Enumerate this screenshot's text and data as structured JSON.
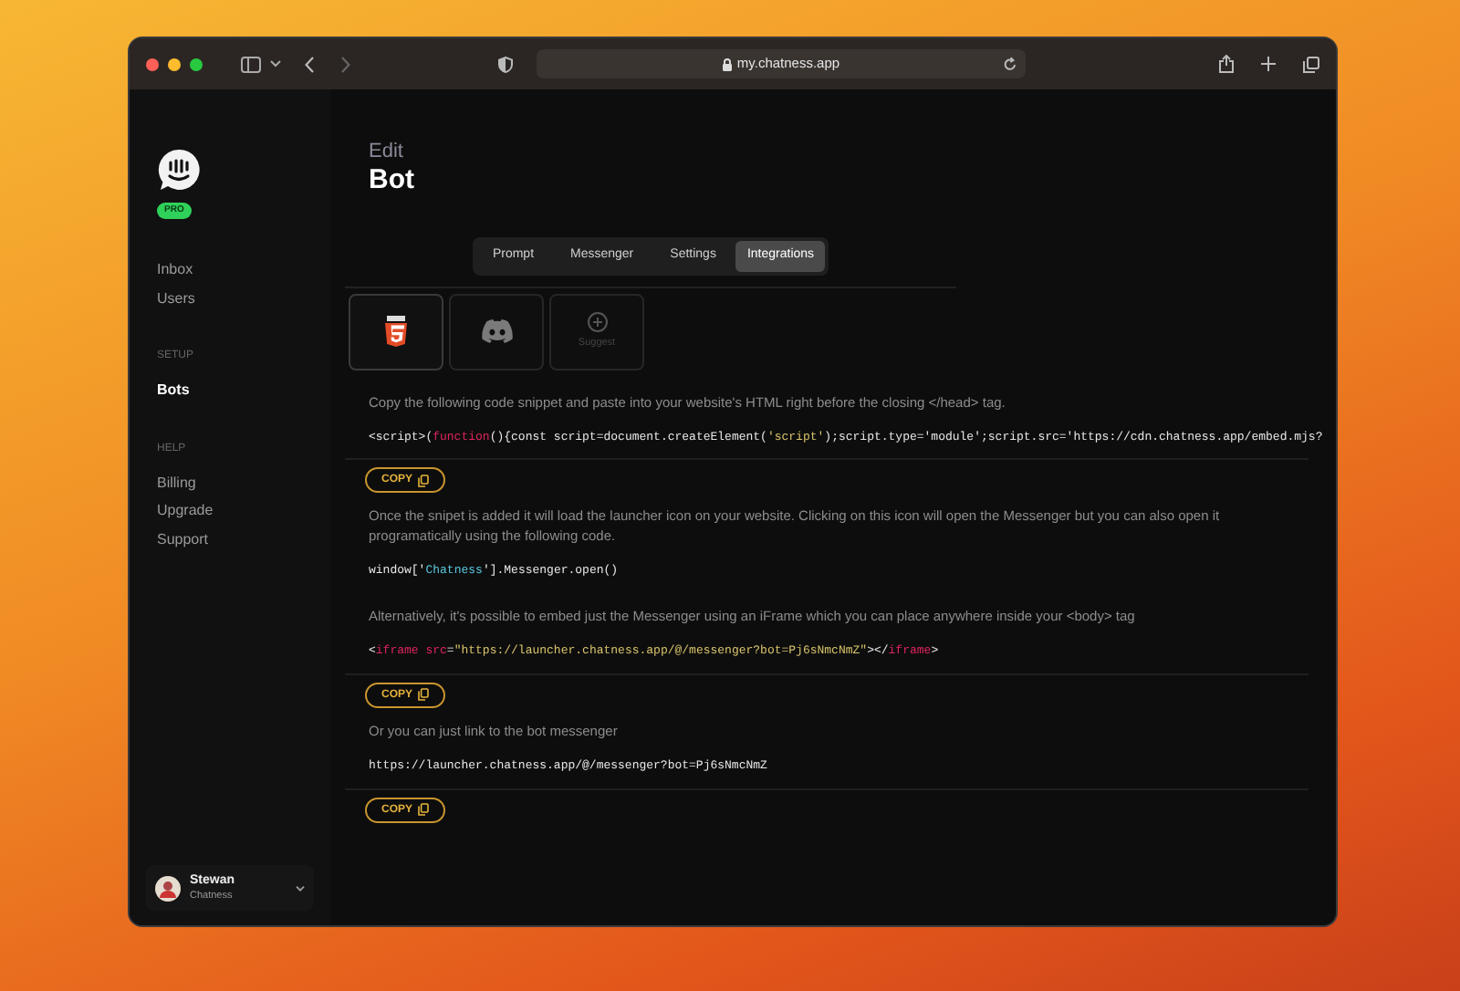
{
  "browser": {
    "url": "my.chatness.app"
  },
  "sidebar": {
    "badge": "PRO",
    "groups": [
      {
        "items": [
          {
            "label": "Inbox",
            "selected": false
          },
          {
            "label": "Users",
            "selected": false
          }
        ]
      },
      {
        "heading": "SETUP",
        "items": [
          {
            "label": "Bots",
            "selected": true
          }
        ]
      },
      {
        "heading": "HELP",
        "items": [
          {
            "label": "Billing",
            "selected": false
          },
          {
            "label": "Upgrade",
            "selected": false
          },
          {
            "label": "Support",
            "selected": false
          }
        ]
      }
    ],
    "user": {
      "name": "Stewan",
      "org": "Chatness"
    }
  },
  "header": {
    "overline": "Edit",
    "title": "Bot"
  },
  "tabs": [
    {
      "label": "Prompt",
      "selected": false
    },
    {
      "label": "Messenger",
      "selected": false
    },
    {
      "label": "Settings",
      "selected": false
    },
    {
      "label": "Integrations",
      "selected": true
    }
  ],
  "integrations": [
    {
      "kind": "html5",
      "selected": true
    },
    {
      "kind": "discord",
      "selected": false
    },
    {
      "kind": "suggest",
      "label": "Suggest",
      "selected": false
    }
  ],
  "blocks": [
    {
      "kind": "text",
      "text": "Copy the following code snippet and paste into your website's HTML right before the closing </head> tag."
    },
    {
      "kind": "code",
      "tokens": [
        {
          "kind": "plain",
          "text": "<script>("
        },
        {
          "kind": "keyword",
          "text": "function"
        },
        {
          "kind": "plain",
          "text": "(){const script=document.createElement("
        },
        {
          "kind": "string",
          "text": "'script'"
        },
        {
          "kind": "plain",
          "text": ");script.type='module';script.src='https://cdn.chatness.app/embed.mjs?"
        }
      ]
    },
    {
      "kind": "copy",
      "label": "COPY"
    },
    {
      "kind": "text",
      "text": "Once the snipet is added it will load the launcher icon on your website. Clicking on this icon will open the Messenger but you can also open it programatically using the following code."
    },
    {
      "kind": "code",
      "tokens": [
        {
          "kind": "plain",
          "text": "window['"
        },
        {
          "kind": "name",
          "text": "Chatness"
        },
        {
          "kind": "plain",
          "text": "'].Messenger.open()"
        }
      ]
    },
    {
      "kind": "text",
      "text": "Alternatively, it's possible to embed just the Messenger using an iFrame which you can place anywhere inside your <body> tag"
    },
    {
      "kind": "code",
      "tokens": [
        {
          "kind": "plain",
          "text": "<"
        },
        {
          "kind": "keyword",
          "text": "iframe src"
        },
        {
          "kind": "plain",
          "text": "="
        },
        {
          "kind": "string",
          "text": "\"https://launcher.chatness.app/@/messenger?bot=Pj6sNmcNmZ\""
        },
        {
          "kind": "plain",
          "text": "></"
        },
        {
          "kind": "keyword",
          "text": "iframe"
        },
        {
          "kind": "plain",
          "text": ">"
        }
      ]
    },
    {
      "kind": "copy",
      "label": "COPY"
    },
    {
      "kind": "text",
      "text": "Or you can just link to the bot messenger"
    },
    {
      "kind": "code",
      "tokens": [
        {
          "kind": "plain",
          "text": "https://launcher.chatness.app/@/messenger?bot=Pj6sNmcNmZ"
        }
      ]
    },
    {
      "kind": "copy",
      "label": "COPY"
    }
  ]
}
